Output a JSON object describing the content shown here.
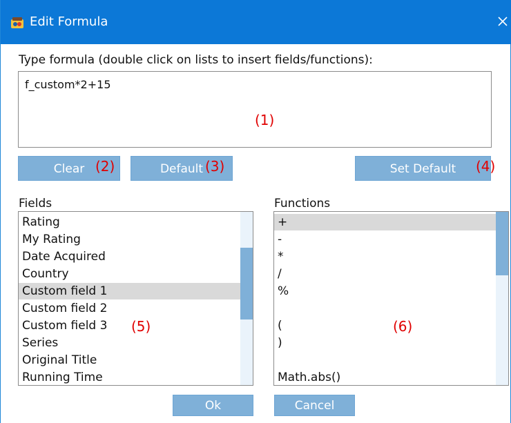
{
  "window": {
    "title": "Edit Formula",
    "accent": "#0c78d7"
  },
  "prompt": "Type formula (double click on lists to insert fields/functions):",
  "formula": {
    "value": "f_custom*2+15"
  },
  "callouts": {
    "c1": "(1)",
    "c2": "(2)",
    "c3": "(3)",
    "c4": "(4)",
    "c5": "(5)",
    "c6": "(6)"
  },
  "buttons": {
    "clear": "Clear",
    "default": "Default",
    "set_default": "Set Default",
    "ok": "Ok",
    "cancel": "Cancel"
  },
  "fields": {
    "label": "Fields",
    "items": [
      "Rating",
      "My Rating",
      "Date Acquired",
      "Country",
      "Custom field 1",
      "Custom field 2",
      "Custom field 3",
      "Series",
      "Original Title",
      "Running Time"
    ],
    "selected": "Custom field 1"
  },
  "functions": {
    "label": "Functions",
    "items": [
      "+",
      "-",
      "*",
      "/",
      "%",
      "",
      "(",
      ")",
      "",
      "Math.abs()"
    ],
    "selected": "+"
  }
}
